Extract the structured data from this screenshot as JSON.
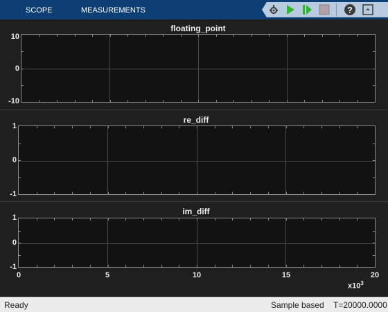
{
  "toolstrip": {
    "tabs": [
      {
        "label": "SCOPE"
      },
      {
        "label": "MEASUREMENTS"
      }
    ],
    "buttons": [
      "settings-icon",
      "run-icon",
      "step-forward-icon",
      "stop-icon",
      "help-icon",
      "expand-icon"
    ]
  },
  "plots": [
    {
      "title": "floating_point",
      "yticks": [
        "10",
        "0",
        "-10"
      ]
    },
    {
      "title": "re_diff",
      "yticks": [
        "1",
        "0",
        "-1"
      ]
    },
    {
      "title": "im_diff",
      "yticks": [
        "1",
        "0",
        "-1"
      ]
    }
  ],
  "x_axis": {
    "ticks": [
      "0",
      "5",
      "10",
      "15",
      "20"
    ],
    "scale_base": "x10",
    "scale_exp": "3"
  },
  "status": {
    "left": "Ready",
    "mode": "Sample based",
    "time": "T=20000.0000"
  },
  "colors": {
    "toolstrip": "#0e3f74",
    "background": "#1f1f1f",
    "axes": "#121212",
    "grid": "#4b4b4b"
  }
}
